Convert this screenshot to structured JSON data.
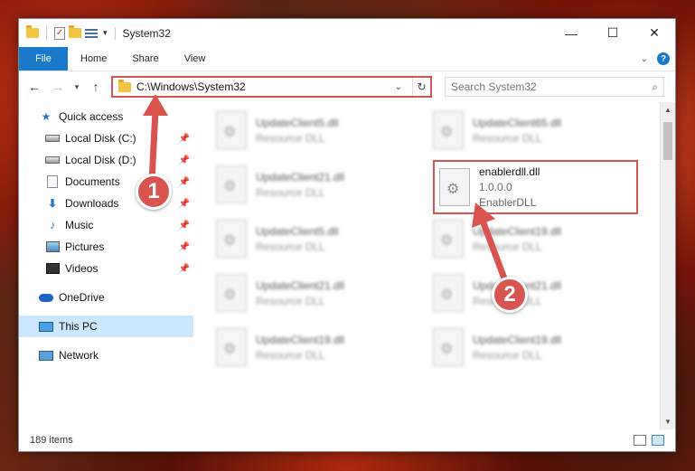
{
  "window": {
    "title": "System32",
    "controls": {
      "minimize": "—",
      "maximize": "☐",
      "close": "✕"
    }
  },
  "ribbon": {
    "tabs": [
      "File",
      "Home",
      "Share",
      "View"
    ],
    "help": "?"
  },
  "address": {
    "path": "C:\\Windows\\System32",
    "search_placeholder": "Search System32"
  },
  "nav_pane": {
    "quick_access": "Quick access",
    "items": [
      {
        "label": "Local Disk (C:)",
        "icon": "drive-icon"
      },
      {
        "label": "Local Disk (D:)",
        "icon": "drive-icon"
      },
      {
        "label": "Documents",
        "icon": "documents-icon"
      },
      {
        "label": "Downloads",
        "icon": "downloads-icon"
      },
      {
        "label": "Music",
        "icon": "music-icon"
      },
      {
        "label": "Pictures",
        "icon": "pictures-icon"
      },
      {
        "label": "Videos",
        "icon": "videos-icon"
      }
    ],
    "onedrive": "OneDrive",
    "this_pc": "This PC",
    "network": "Network"
  },
  "files": [
    {
      "name": "UpdateClient5.dll",
      "type": "Resource DLL"
    },
    {
      "name": "UpdateClient65.dll",
      "type": "Resource DLL"
    },
    {
      "name": "UpdateClient21.dll",
      "type": "Resource DLL"
    },
    {
      "name": "UpdateClient5.dll",
      "type": "Resource DLL"
    },
    {
      "name": "UpdateClient19.dll",
      "type": "Resource DLL"
    },
    {
      "name": "UpdateClient21.dll",
      "type": "Resource DLL"
    },
    {
      "name": "UpdateClient21.dll",
      "type": "Resource DLL"
    },
    {
      "name": "UpdateClient19.dll",
      "type": "Resource DLL"
    },
    {
      "name": "UpdateClient19.dll",
      "type": "Resource DLL"
    }
  ],
  "highlighted_file": {
    "name": "enablerdll.dll",
    "version": "1.0.0.0",
    "description": "EnablerDLL"
  },
  "status": {
    "item_count": "189 items"
  },
  "callouts": {
    "one": "1",
    "two": "2"
  },
  "colors": {
    "accent": "#1979ca",
    "highlight": "#d9534f",
    "selected": "#cce8ff"
  }
}
